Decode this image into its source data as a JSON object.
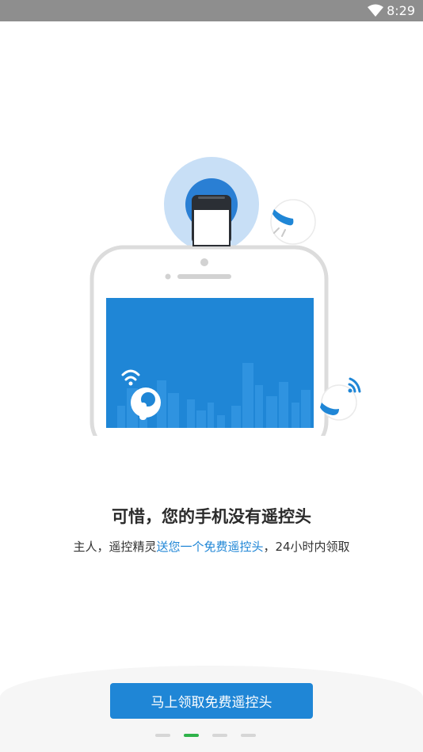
{
  "status_bar": {
    "time": "8:29",
    "wifi_icon": "wifi-icon"
  },
  "main": {
    "headline": "可惜，您的手机没有遥控头",
    "description_prefix": "主人，遥控精灵",
    "description_highlight": "送您一个免费遥控头",
    "description_suffix": "，24小时内领取",
    "cta_label": "马上领取免费遥控头"
  },
  "pager": {
    "page_count": 4,
    "active_index": 1
  },
  "colors": {
    "accent": "#1f86d6",
    "status_bar": "#8e8e8e",
    "active_dot": "#2fb34a",
    "inactive_dot": "#d6d6d6"
  }
}
